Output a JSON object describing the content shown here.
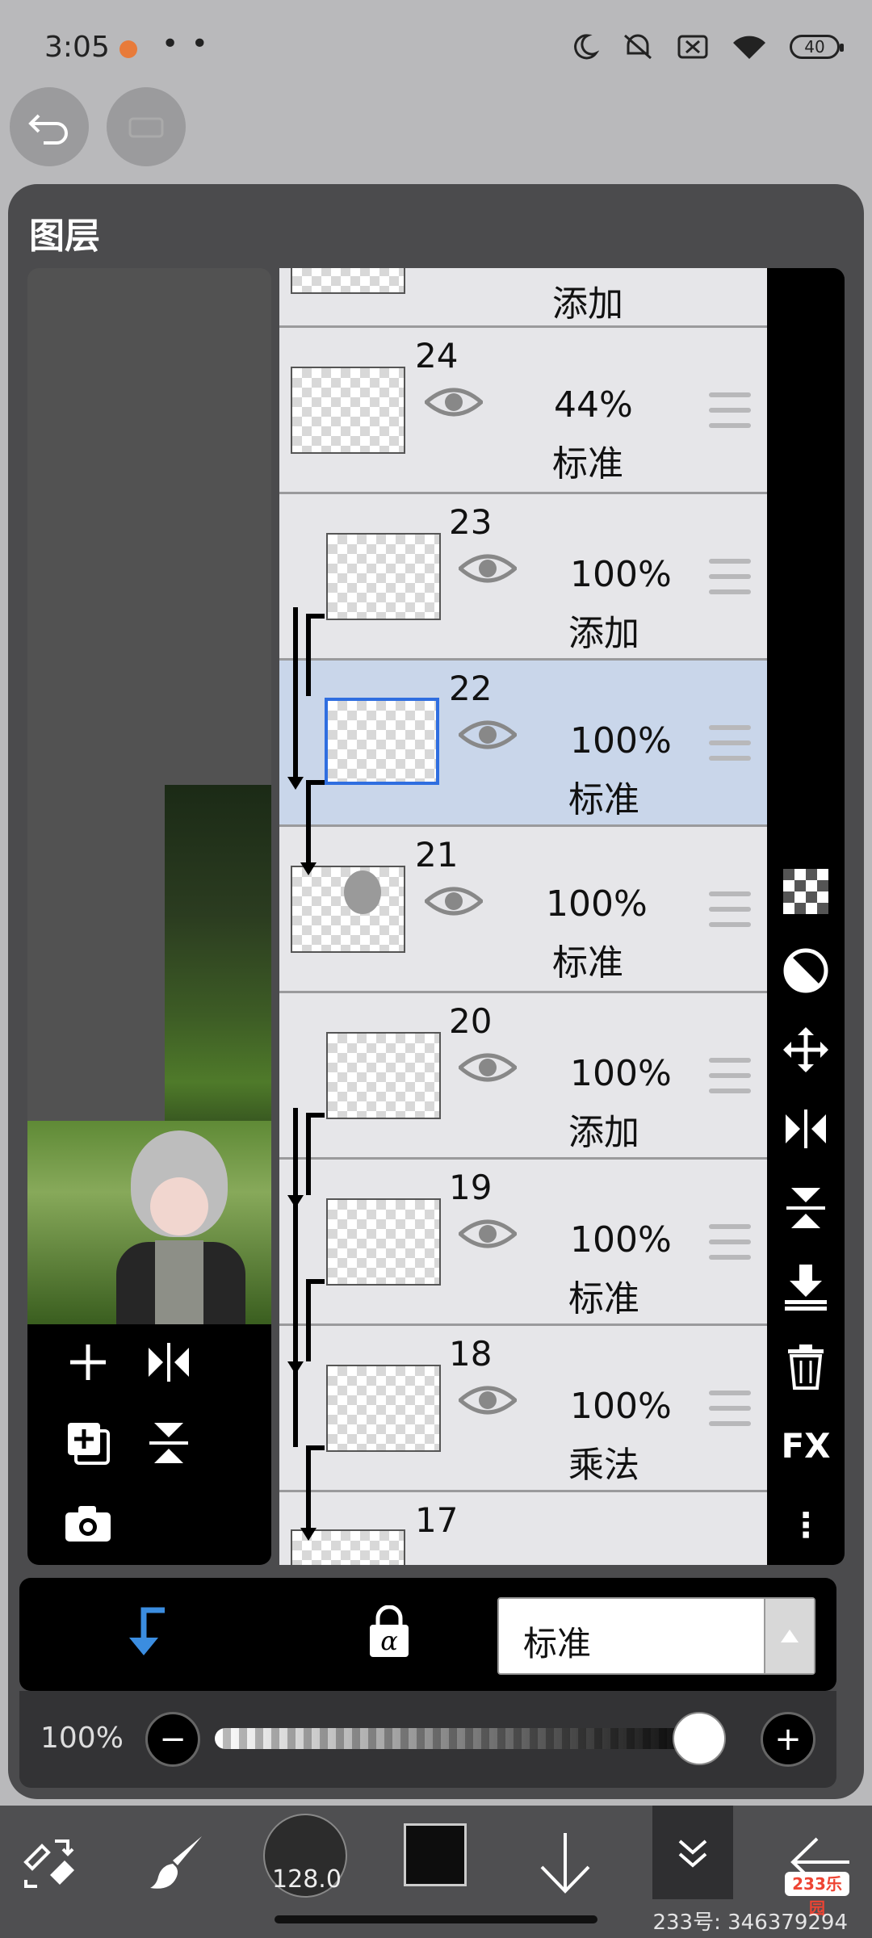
{
  "status_bar": {
    "time": "3:05",
    "dots": "• •",
    "battery": "40"
  },
  "panel": {
    "title": "图层"
  },
  "layers": [
    {
      "num": "",
      "opacity": "",
      "blend": "添加"
    },
    {
      "num": "24",
      "opacity": "44%",
      "blend": "标准"
    },
    {
      "num": "23",
      "opacity": "100%",
      "blend": "添加"
    },
    {
      "num": "22",
      "opacity": "100%",
      "blend": "标准"
    },
    {
      "num": "21",
      "opacity": "100%",
      "blend": "标准"
    },
    {
      "num": "20",
      "opacity": "100%",
      "blend": "添加"
    },
    {
      "num": "19",
      "opacity": "100%",
      "blend": "标准"
    },
    {
      "num": "18",
      "opacity": "100%",
      "blend": "乘法"
    },
    {
      "num": "17",
      "opacity": "",
      "blend": ""
    }
  ],
  "right_tools": {
    "fx_label": "FX",
    "more": "⋮"
  },
  "blend_bar": {
    "blend_mode": "标准"
  },
  "opacity_row": {
    "label": "100%",
    "minus": "−",
    "plus": "+",
    "value": 1.0
  },
  "bottom_bar": {
    "brush_size": "128.0"
  },
  "watermark": {
    "logo": "233乐园",
    "text": "233号: 346379294"
  },
  "colors": {
    "accent_blue": "#3b8de0",
    "selected_row": "#c9d6ea",
    "panel_bg": "#4b4b4d"
  }
}
